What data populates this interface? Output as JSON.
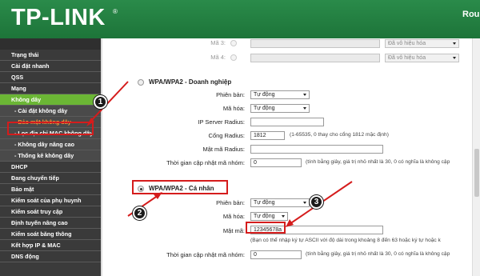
{
  "header": {
    "logo": "TP-LINK",
    "logo_mark": "®",
    "right_text": "Rou"
  },
  "sidebar": {
    "items": [
      {
        "label": "Trạng thái"
      },
      {
        "label": "Cài đặt nhanh"
      },
      {
        "label": "QSS"
      },
      {
        "label": "Mạng"
      },
      {
        "label": "Không dây"
      },
      {
        "label": "- Cài đặt không dây"
      },
      {
        "label": "- Bảo mật không dây"
      },
      {
        "label": "- Lọc địa chỉ MAC không dây"
      },
      {
        "label": "- Không dây nâng cao"
      },
      {
        "label": "- Thống kê không dây"
      },
      {
        "label": "DHCP"
      },
      {
        "label": "Đang chuyển tiếp"
      },
      {
        "label": "Bảo mật"
      },
      {
        "label": "Kiểm soát của phụ huynh"
      },
      {
        "label": "Kiểm soát truy cập"
      },
      {
        "label": "Định tuyến nâng cao"
      },
      {
        "label": "Kiểm soát băng thông"
      },
      {
        "label": "Kết hợp IP & MAC"
      },
      {
        "label": "DNS động"
      }
    ]
  },
  "wep_keys": [
    {
      "label": "Mã 3:",
      "select": "Đã vô hiệu hóa"
    },
    {
      "label": "Mã 4:",
      "select": "Đã vô hiệu hóa"
    }
  ],
  "enterprise": {
    "title": "WPA/WPA2 - Doanh nghiệp",
    "version_label": "Phiên bản:",
    "version_value": "Tự động",
    "encryption_label": "Mã hóa:",
    "encryption_value": "Tự động",
    "radius_ip_label": "IP Server Radius:",
    "radius_ip_value": "",
    "radius_port_label": "Cổng Radius:",
    "radius_port_value": "1812",
    "radius_port_note": "(1-65535, 0 thay cho cổng 1812 mặc định)",
    "radius_password_label": "Mật mã Radius:",
    "radius_password_value": "",
    "group_key_label": "Thời gian cập nhật mã nhóm:",
    "group_key_value": "0",
    "group_key_note": "(tính bằng giây, giá trị nhỏ nhất là 30, 0 có nghĩa là không cập"
  },
  "personal": {
    "title": "WPA/WPA2 - Cá nhân",
    "version_label": "Phiên bản:",
    "version_value": "Tự động",
    "encryption_label": "Mã hóa:",
    "encryption_value": "Tự động",
    "password_label": "Mật mã:",
    "password_value": "12345678a",
    "password_note": "(Bạn có thể nhập ký tự ASCII với độ dài trong khoảng 8 đến 63 hoặc ký tự hoặc k",
    "group_key_label": "Thời gian cập nhật mã nhóm:",
    "group_key_value": "0",
    "group_key_note": "(tính bằng giây, giá trị nhỏ nhất là 30, 0 có nghĩa là không cập"
  },
  "markers": [
    "1",
    "2",
    "3"
  ],
  "colors": {
    "header_green": "#1d7439",
    "active_green": "#6bb635",
    "annotation_red": "#d51c1c",
    "sidebar_dark": "#3a3a3a"
  }
}
